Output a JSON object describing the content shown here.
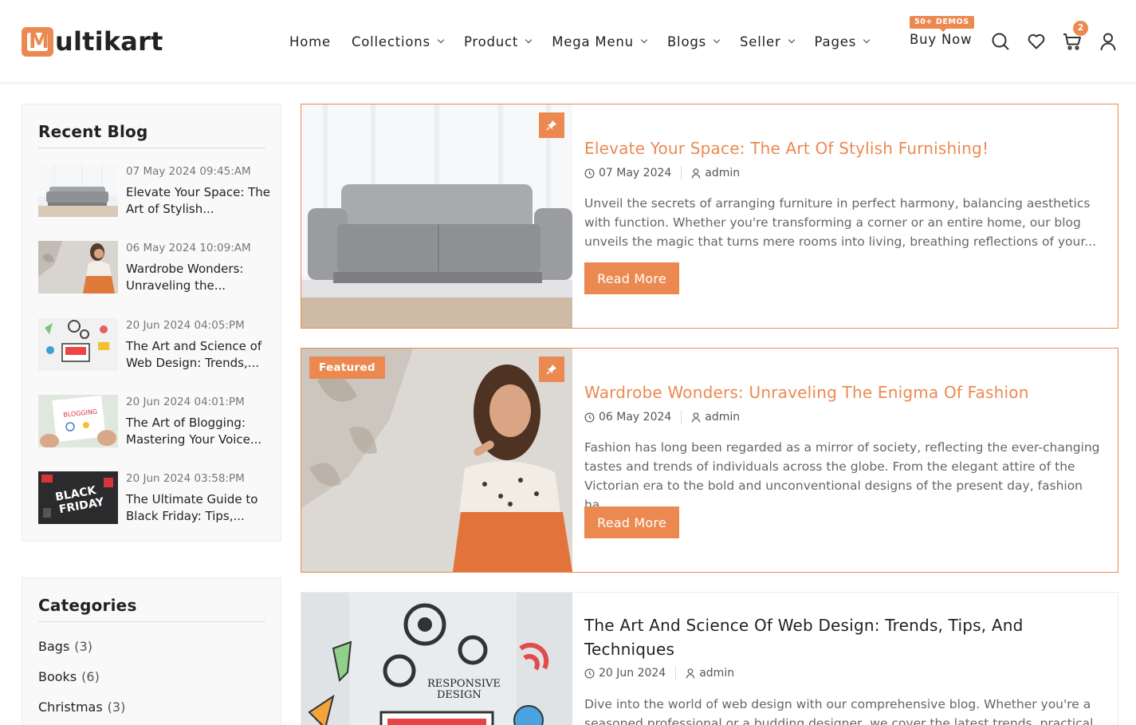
{
  "brand": {
    "logo_letter": "M",
    "logo_rest": "ultikart",
    "accent": "#ec8951"
  },
  "nav": {
    "items": [
      "Home",
      "Collections",
      "Product",
      "Mega Menu",
      "Blogs",
      "Seller",
      "Pages"
    ],
    "buy_now": "Buy Now",
    "demo_badge": "50+ DEMOS",
    "cart_count": "2",
    "icons": [
      "search-icon",
      "heart-icon",
      "cart-icon",
      "user-icon"
    ]
  },
  "sidebar": {
    "recent_title": "Recent Blog",
    "recent": [
      {
        "date": "07 May 2024 09:45:AM",
        "title": "Elevate Your Space: The Art of Stylish..."
      },
      {
        "date": "06 May 2024 10:09:AM",
        "title": "Wardrobe Wonders: Unraveling the..."
      },
      {
        "date": "20 Jun 2024 04:05:PM",
        "title": "The Art and Science of Web Design: Trends,..."
      },
      {
        "date": "20 Jun 2024 04:01:PM",
        "title": "The Art of Blogging: Mastering Your Voice..."
      },
      {
        "date": "20 Jun 2024 03:58:PM",
        "title": "The Ultimate Guide to Black Friday: Tips,..."
      }
    ],
    "categories_title": "Categories",
    "categories": [
      {
        "name": "Bags",
        "count": "(3)"
      },
      {
        "name": "Books",
        "count": "(6)"
      },
      {
        "name": "Christmas",
        "count": "(3)"
      }
    ]
  },
  "posts": [
    {
      "title": "Elevate Your Space: The Art Of Stylish Furnishing!",
      "date": "07 May 2024",
      "author": "admin",
      "excerpt": "Unveil the secrets of arranging furniture in perfect harmony, balancing aesthetics with function. Whether you're transforming a corner or an entire home, our blog unveils the magic that turns mere rooms into living, breathing reflections of your...",
      "button": "Read More"
    },
    {
      "badge": "Featured",
      "title": "Wardrobe Wonders: Unraveling The Enigma Of Fashion",
      "date": "06 May 2024",
      "author": "admin",
      "excerpt": "Fashion has long been regarded as a mirror of society, reflecting the ever-changing tastes and trends of individuals across the globe. From the elegant attire of the Victorian era to the bold and unconventional designs of the present day, fashion ha...",
      "button": "Read More"
    },
    {
      "title": "The Art And Science Of Web Design: Trends, Tips, And Techniques",
      "date": "20 Jun 2024",
      "author": "admin",
      "excerpt": "Dive into the world of web design with our comprehensive blog. Whether you're a seasoned professional or a budding designer, we cover the latest trends, practical",
      "image_text": [
        "RESPONSIVE",
        "DESIGN"
      ]
    }
  ],
  "thumb_text": {
    "blogging": "BLOGGING",
    "black_friday": [
      "BLACK",
      "FRIDAY"
    ]
  }
}
